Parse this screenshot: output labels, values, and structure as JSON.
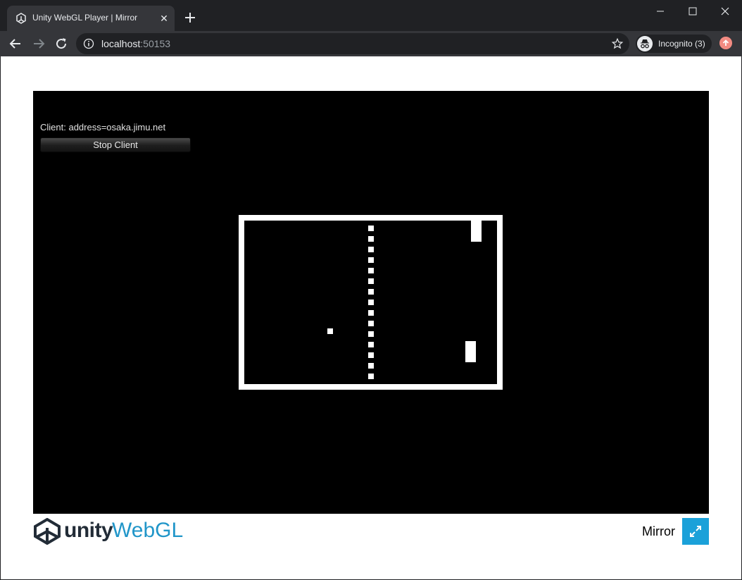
{
  "browser": {
    "tab_title": "Unity WebGL Player | Mirror",
    "url_host": "localhost",
    "url_port": ":50153",
    "incognito_label": "Incognito (3)"
  },
  "game": {
    "client_status": "Client: address=osaka.jimu.net",
    "stop_client_label": "Stop Client"
  },
  "footer": {
    "logo_unity": "unity",
    "logo_webgl": "WebGL",
    "build_title": "Mirror"
  },
  "icons": [
    "unity-icon",
    "close-icon",
    "plus-icon",
    "minimize-icon",
    "maximize-icon",
    "back-icon",
    "forward-icon",
    "reload-icon",
    "info-icon",
    "star-icon",
    "incognito-icon",
    "update-icon",
    "fullscreen-icon"
  ],
  "colors": {
    "browser_frame": "#202124",
    "toolbar": "#35363a",
    "canvas": "#000000",
    "unity_blue": "#1ba1d9"
  }
}
